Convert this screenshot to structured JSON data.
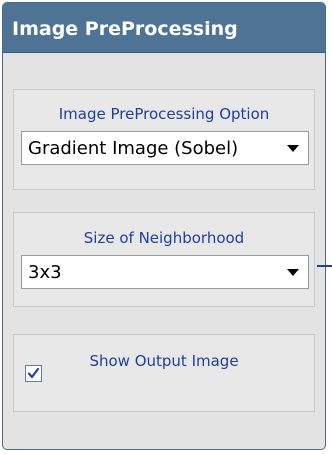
{
  "panel": {
    "title": "Image PreProcessing"
  },
  "preprocessing_option": {
    "label": "Image PreProcessing Option",
    "selected": "Gradient Image (Sobel)"
  },
  "neighborhood_size": {
    "label": "Size of Neighborhood",
    "selected": "3x3"
  },
  "show_output": {
    "label": "Show Output Image",
    "checked": true
  },
  "icons": {
    "dropdown_arrow": "chevron-down-icon",
    "checkmark": "check-icon"
  },
  "colors": {
    "header": "#4f7394",
    "label_text": "#1f3f9c",
    "panel_background": "#e3e3e3"
  }
}
